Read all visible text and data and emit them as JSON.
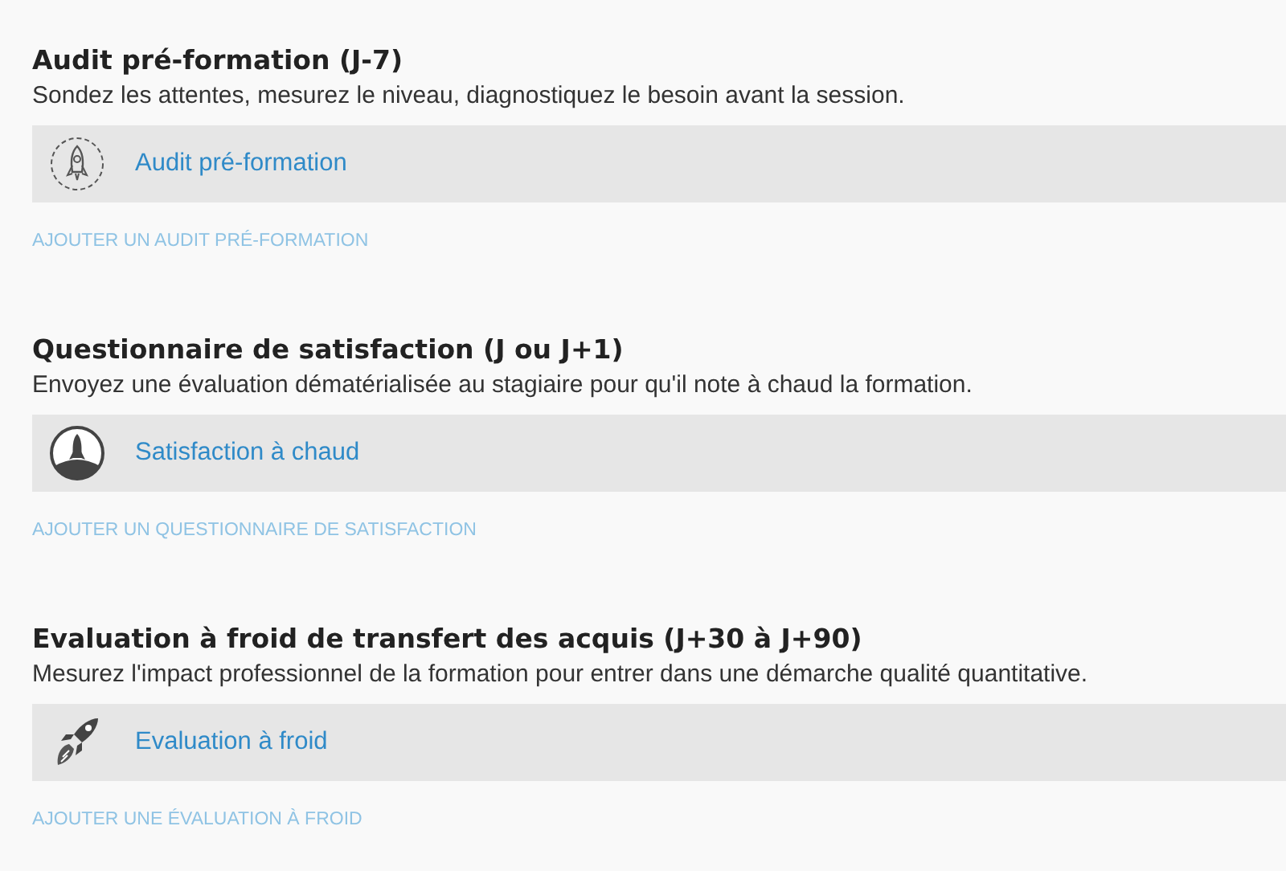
{
  "sections": [
    {
      "title": "Audit pré-formation (J-7)",
      "description": "Sondez les attentes, mesurez le niveau, diagnostiquez le besoin avant la session.",
      "item": {
        "label": "Audit pré-formation",
        "kind": "outline"
      },
      "add_link": "AJOUTER UN AUDIT PRÉ-FORMATION"
    },
    {
      "title": "Questionnaire de satisfaction (J ou J+1)",
      "description": "Envoyez une évaluation dématérialisée au stagiaire pour qu'il note à chaud la formation.",
      "item": {
        "label": "Satisfaction à chaud",
        "kind": "disc"
      },
      "add_link": "AJOUTER UN QUESTIONNAIRE DE SATISFACTION"
    },
    {
      "title": "Evaluation à froid de transfert des acquis (J+30 à J+90)",
      "description": "Mesurez l'impact professionnel de la formation pour entrer dans une démarche qualité quantitative.",
      "item": {
        "label": "Evaluation à froid",
        "kind": "launch"
      },
      "add_link": "AJOUTER UNE ÉVALUATION À FROID"
    }
  ]
}
